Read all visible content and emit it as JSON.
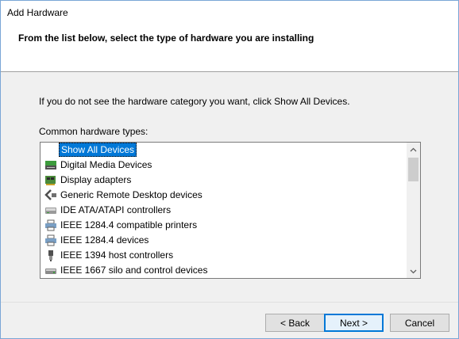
{
  "window": {
    "title": "Add Hardware"
  },
  "header": {
    "heading": "From the list below, select the type of hardware you are installing"
  },
  "body": {
    "instruction": "If you do not see the hardware category you want, click Show All Devices.",
    "list_label": "Common hardware types:"
  },
  "list": {
    "items": [
      {
        "label": "Show All Devices",
        "icon": "none",
        "selected": true
      },
      {
        "label": "Digital Media Devices",
        "icon": "media-device-icon"
      },
      {
        "label": "Display adapters",
        "icon": "display-adapter-icon"
      },
      {
        "label": "Generic Remote Desktop devices",
        "icon": "remote-desktop-icon"
      },
      {
        "label": "IDE ATA/ATAPI controllers",
        "icon": "ide-controller-icon"
      },
      {
        "label": "IEEE 1284.4 compatible printers",
        "icon": "printer-icon"
      },
      {
        "label": "IEEE 1284.4 devices",
        "icon": "printer-icon"
      },
      {
        "label": "IEEE 1394 host controllers",
        "icon": "host-controller-icon"
      },
      {
        "label": "IEEE 1667 silo and control devices",
        "icon": "silo-device-icon"
      }
    ]
  },
  "buttons": {
    "back": "< Back",
    "next": "Next >",
    "cancel": "Cancel"
  },
  "colors": {
    "selection": "#0078d7",
    "window_border": "#7aa6d6",
    "header_bg": "#ffffff",
    "body_bg": "#f0f0f0"
  }
}
